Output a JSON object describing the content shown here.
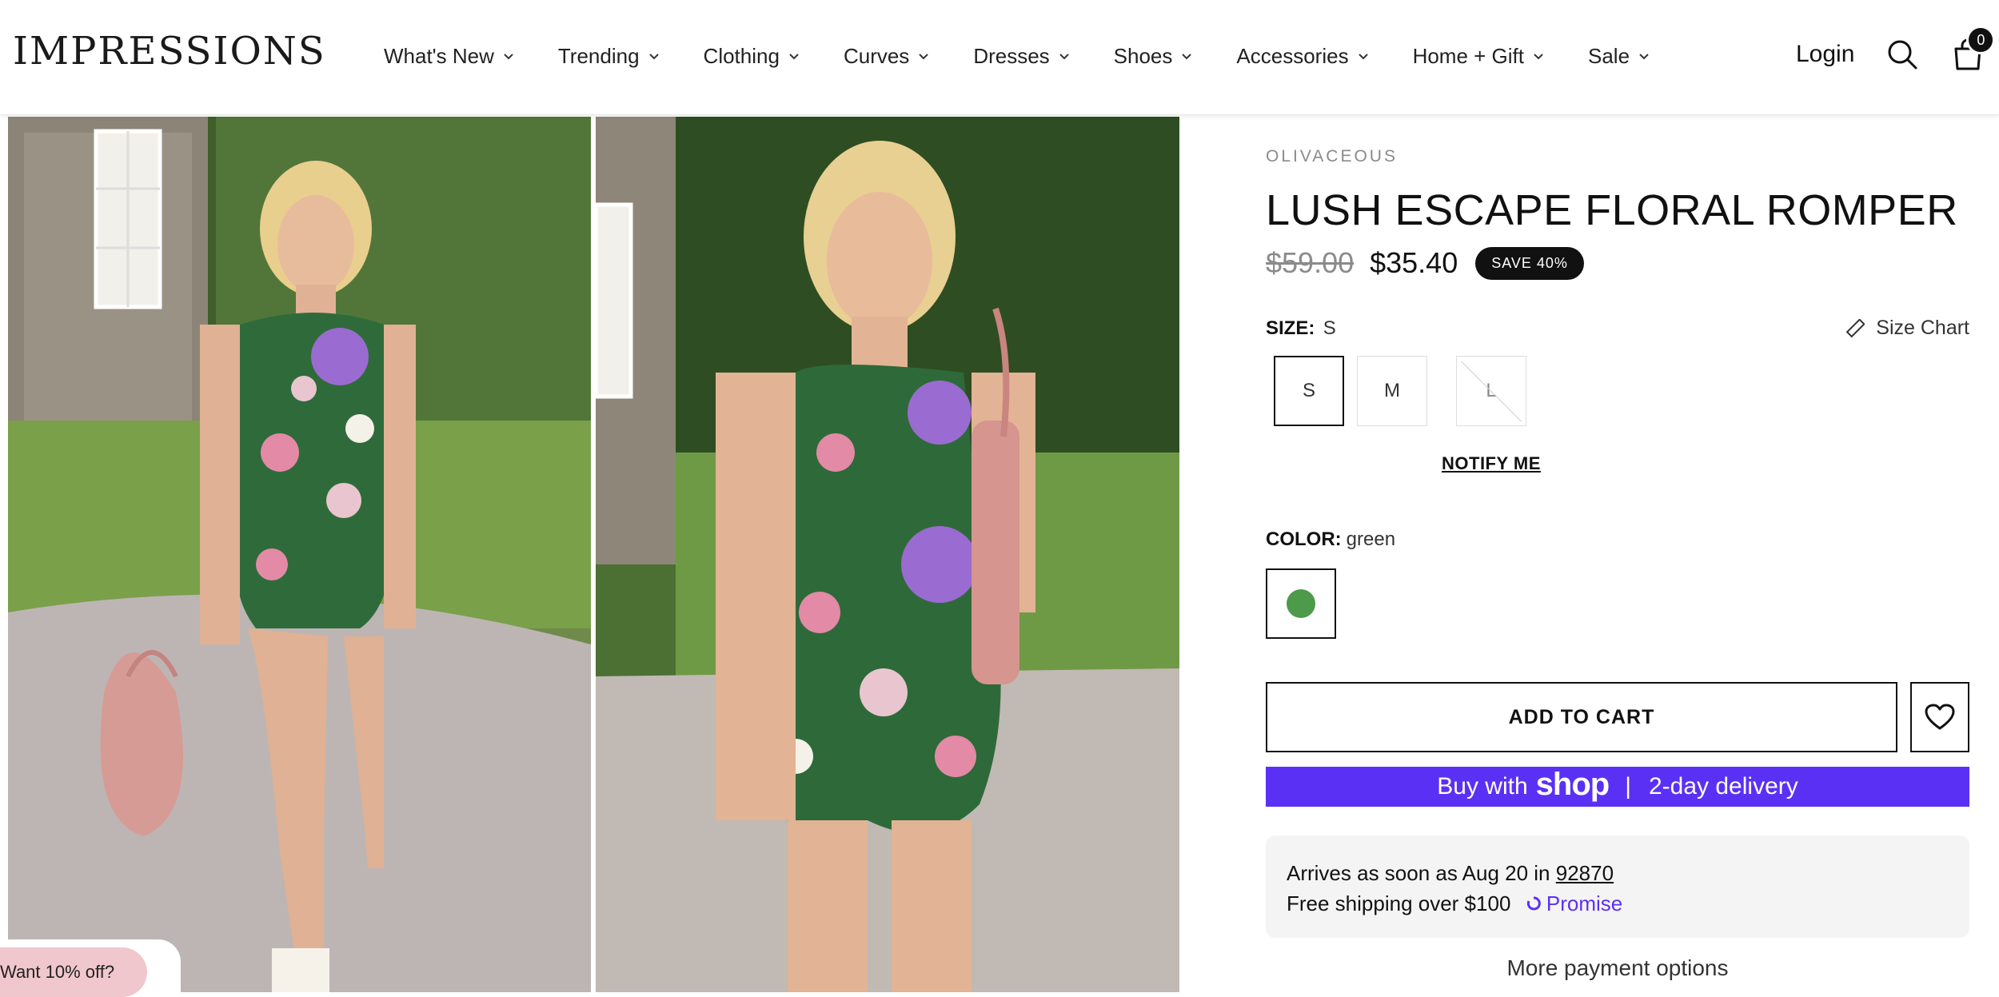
{
  "header": {
    "logo": "IMPRESSIONS",
    "nav": [
      {
        "label": "What's New"
      },
      {
        "label": "Trending"
      },
      {
        "label": "Clothing"
      },
      {
        "label": "Curves"
      },
      {
        "label": "Dresses"
      },
      {
        "label": "Shoes"
      },
      {
        "label": "Accessories"
      },
      {
        "label": "Home + Gift"
      },
      {
        "label": "Sale"
      }
    ],
    "login_label": "Login",
    "cart_count": "0",
    "icons": [
      "search-icon",
      "cart-icon",
      "chevron-down-icon"
    ]
  },
  "promo": {
    "label": "Want 10% off?"
  },
  "product": {
    "brand": "OLIVACEOUS",
    "title": "LUSH ESCAPE FLORAL ROMPER",
    "original_price": "$59.00",
    "sale_price": "$35.40",
    "save_badge": "SAVE 40%",
    "size": {
      "label": "SIZE:",
      "selected": "S",
      "chart_label": "Size Chart",
      "options": [
        {
          "label": "S",
          "state": "selected"
        },
        {
          "label": "M",
          "state": "available"
        },
        {
          "label": "L",
          "state": "sold-out"
        }
      ],
      "notify_label": "NOTIFY ME"
    },
    "color": {
      "label": "COLOR:",
      "selected": "green",
      "swatch_hex": "#4d9a4a"
    },
    "add_to_cart_label": "ADD TO CART",
    "shop_pay": {
      "prefix": "Buy with",
      "brand": "shop",
      "separator": "|",
      "suffix": "2-day delivery",
      "color": "#5a31f4"
    },
    "shipping": {
      "arrives_prefix": "Arrives as soon as Aug 20 in",
      "zip": "92870",
      "free_shipping": "Free shipping over $100",
      "promise_label": "Promise"
    },
    "more_payment_label": "More payment options"
  }
}
